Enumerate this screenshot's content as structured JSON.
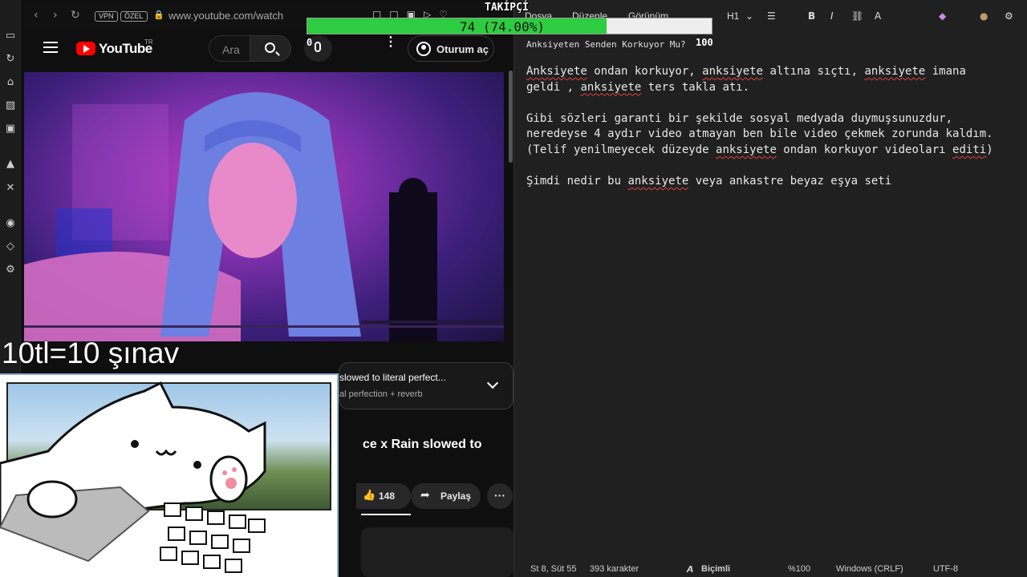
{
  "browser": {
    "url": "www.youtube.com/watch",
    "pills": [
      "VPN",
      "ÖZEL"
    ]
  },
  "youtube": {
    "logo_text": "YouTube",
    "logo_region": "TR",
    "search_placeholder": "Ara",
    "signin_label": "Oturum aç",
    "playlist": {
      "title": "slowed to literal perfect...",
      "subtitle": "al perfection + reverb"
    },
    "video_title": "ce x Rain slowed to",
    "like_count": "148",
    "share_label": "Paylaş"
  },
  "overlays": {
    "follower_label": "TAKİPÇİ",
    "follower_progress_text": "74 (74.00%)",
    "follower_fraction": 0.74,
    "follower_min": "0",
    "follower_max": "100",
    "donation_text": "10tl=10 şınav"
  },
  "editor": {
    "menu": [
      "Dosya",
      "Düzenle",
      "Görünüm"
    ],
    "heading_select": "H1",
    "doc_title": "Anksiyeten Senden Korkuyor Mu?",
    "paragraphs": [
      [
        [
          "Anksiyete",
          true
        ],
        [
          " ondan korkuyor, ",
          false
        ],
        [
          "anksiyete",
          true
        ],
        [
          " altına sıçtı, ",
          false
        ],
        [
          "anksiyete",
          true
        ],
        [
          " imana\ngeldi , ",
          false
        ],
        [
          "anksiyete",
          true
        ],
        [
          " ters takla atı.",
          false
        ]
      ],
      [
        [
          "Gibi sözleri garanti bir şekilde sosyal medyada duymuşsunuzdur,\nneredeyse 4 aydır video atmayan ben bile video çekmek zorunda kaldım.\n(Telif yenilmeyecek düzeyde ",
          false
        ],
        [
          "anksiyete",
          true
        ],
        [
          " ondan korkuyor videoları ",
          false
        ],
        [
          "editi",
          true
        ],
        [
          ")",
          false
        ]
      ],
      [
        [
          "Şimdi nedir bu ",
          false
        ],
        [
          "anksiyete",
          true
        ],
        [
          " veya ankastre beyaz eşya seti",
          false
        ]
      ]
    ],
    "status": {
      "position": "St 8, Süt 55",
      "char_count": "393 karakter",
      "format": "Biçimli",
      "zoom": "%100",
      "line_ending": "Windows (CRLF)",
      "encoding": "UTF-8"
    }
  }
}
